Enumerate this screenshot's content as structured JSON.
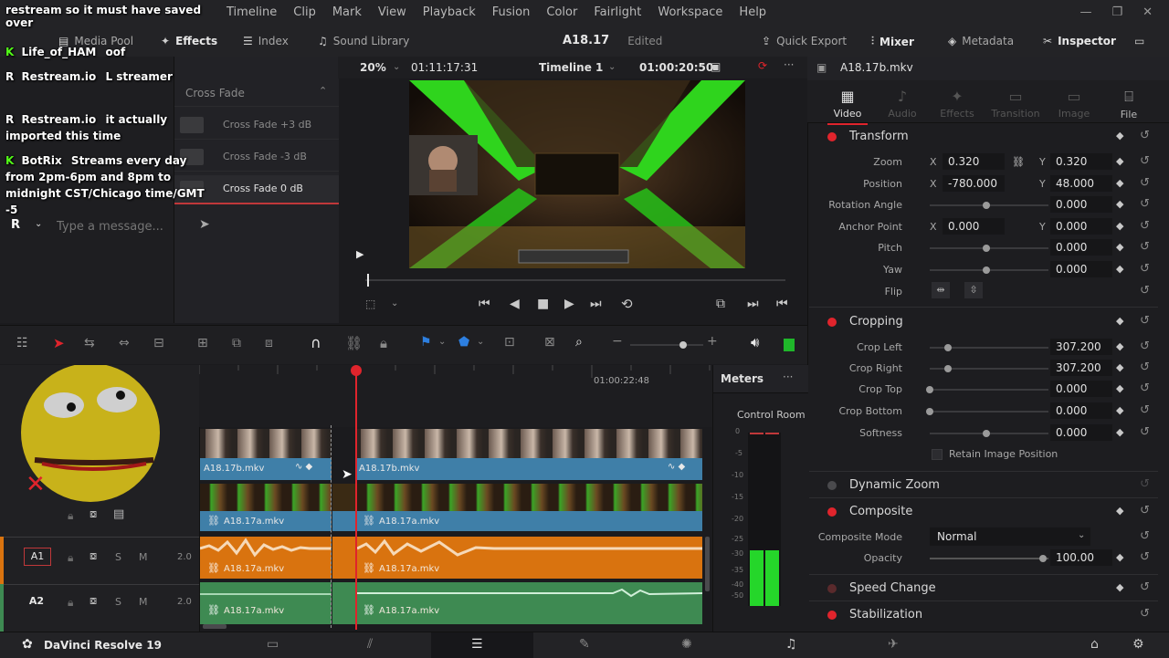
{
  "menu": {
    "items": [
      "Timeline",
      "Clip",
      "Mark",
      "View",
      "Playback",
      "Fusion",
      "Color",
      "Fairlight",
      "Workspace",
      "Help"
    ]
  },
  "toolbar": {
    "media_pool": "Media Pool",
    "effects": "Effects",
    "index": "Index",
    "sound_library": "Sound Library",
    "project_name": "A18.17",
    "project_status": "Edited",
    "quick_export": "Quick Export",
    "mixer": "Mixer",
    "metadata": "Metadata",
    "inspector": "Inspector"
  },
  "effects_panel": {
    "header": "Cross Fade",
    "items": [
      "Cross Fade +3 dB",
      "Cross Fade -3 dB",
      "Cross Fade 0 dB"
    ],
    "selected_index": 2
  },
  "viewer": {
    "zoom": "20%",
    "source_timecode": "01:11:17:31",
    "timeline_name": "Timeline 1",
    "current_timecode": "01:00:20:50",
    "clip_name": "A18.17b.mkv"
  },
  "inspector": {
    "tabs": [
      {
        "label": "Video",
        "icon": "film-icon",
        "active": true
      },
      {
        "label": "Audio",
        "icon": "music-icon",
        "active": false
      },
      {
        "label": "Effects",
        "icon": "wand-icon",
        "active": false
      },
      {
        "label": "Transition",
        "icon": "transition-icon",
        "active": false
      },
      {
        "label": "Image",
        "icon": "image-icon",
        "active": false
      },
      {
        "label": "File",
        "icon": "file-icon",
        "active": false
      }
    ],
    "transform": {
      "title": "Transform",
      "zoom_label": "Zoom",
      "zoom_x": "0.320",
      "zoom_y": "0.320",
      "position_label": "Position",
      "position_x": "-780.000",
      "position_y": "48.000",
      "rotation_label": "Rotation Angle",
      "rotation": "0.000",
      "anchor_label": "Anchor Point",
      "anchor_x": "0.000",
      "anchor_y": "0.000",
      "pitch_label": "Pitch",
      "pitch": "0.000",
      "yaw_label": "Yaw",
      "yaw": "0.000",
      "flip_label": "Flip"
    },
    "cropping": {
      "title": "Cropping",
      "crop_left_label": "Crop Left",
      "crop_left": "307.200",
      "crop_right_label": "Crop Right",
      "crop_right": "307.200",
      "crop_top_label": "Crop Top",
      "crop_top": "0.000",
      "crop_bottom_label": "Crop Bottom",
      "crop_bottom": "0.000",
      "softness_label": "Softness",
      "softness": "0.000",
      "retain_label": "Retain Image Position"
    },
    "dynamic_zoom": {
      "title": "Dynamic Zoom"
    },
    "composite": {
      "title": "Composite",
      "mode_label": "Composite Mode",
      "mode": "Normal",
      "opacity_label": "Opacity",
      "opacity": "100.00"
    },
    "speed_change": {
      "title": "Speed Change"
    },
    "stabilization": {
      "title": "Stabilization"
    }
  },
  "timeline": {
    "ruler_timecode": "01:00:22:48",
    "clips": {
      "v2_a": "A18.17b.mkv",
      "v2_b": "A18.17b.mkv",
      "v1_a": "A18.17a.mkv",
      "v1_b": "A18.17a.mkv",
      "a1_a": "A18.17a.mkv",
      "a1_b": "A18.17a.mkv",
      "a2_a": "A18.17a.mkv",
      "a2_b": "A18.17a.mkv"
    },
    "tracks": {
      "a1": "A1",
      "a2": "A2",
      "channels": "2.0",
      "solo": "S",
      "mute": "M"
    }
  },
  "meters": {
    "title": "Meters",
    "control_room": "Control Room",
    "scale": [
      "0",
      "-5",
      "-10",
      "-15",
      "-20",
      "-25",
      "-30",
      "-35",
      "-40",
      "-50"
    ],
    "level": 0.32
  },
  "pagebar": {
    "app_name": "DaVinci Resolve 19"
  },
  "chat": {
    "messages": [
      {
        "user": "",
        "text": "restream so it must have saved over",
        "badge": ""
      },
      {
        "user": "Life_of_HAM",
        "text": "oof",
        "badge": "K"
      },
      {
        "user": "Restream.io",
        "text": "L streamer",
        "badge": "R"
      },
      {
        "user": "Restream.io",
        "text": "it actually imported this time",
        "badge": "R"
      },
      {
        "user": "BotRix",
        "text": "Streams every day from 2pm-6pm and 8pm to midnight CST/Chicago time/GMT -5",
        "badge": "K"
      }
    ],
    "input_placeholder": "Type a message..."
  },
  "colors": {
    "accent_red": "#e0242c",
    "video_clip": "#3f7fa8",
    "audio_a1": "#d9730f",
    "audio_a2": "#3e8a52",
    "kick_green": "#53fc18"
  }
}
